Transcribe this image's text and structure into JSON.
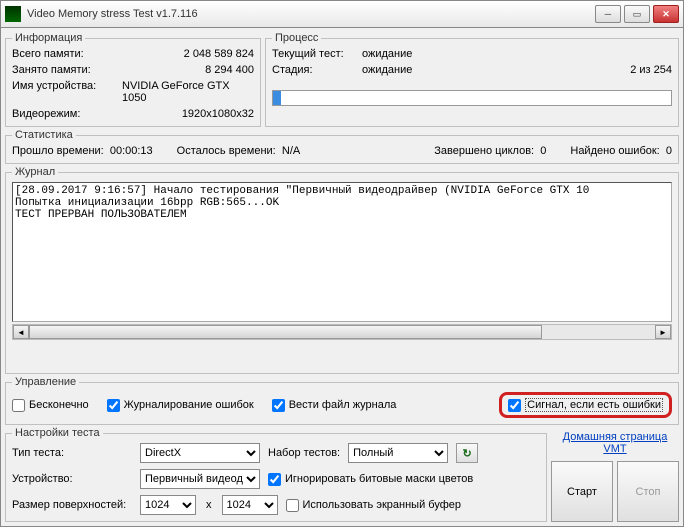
{
  "window": {
    "title": "Video Memory stress Test v1.7.116"
  },
  "info": {
    "legend": "Информация",
    "total_label": "Всего памяти:",
    "total": "2 048 589 824",
    "used_label": "Занято памяти:",
    "used": "8 294 400",
    "device_label": "Имя устройства:",
    "device": "NVIDIA GeForce GTX 1050",
    "mode_label": "Видеорежим:",
    "mode": "1920x1080x32"
  },
  "process": {
    "legend": "Процесс",
    "current_label": "Текущий тест:",
    "current": "ожидание",
    "stage_label": "Стадия:",
    "stage": "ожидание",
    "counter": "2 из 254"
  },
  "stats": {
    "legend": "Статистика",
    "elapsed_label": "Прошло времени:",
    "elapsed": "00:00:13",
    "remain_label": "Осталось времени:",
    "remain": "N/A",
    "cycles_label": "Завершено циклов:",
    "cycles": "0",
    "errors_label": "Найдено ошибок:",
    "errors": "0"
  },
  "log": {
    "legend": "Журнал",
    "text": "[28.09.2017 9:16:57] Начало тестирования \"Первичный видеодрайвер (NVIDIA GeForce GTX 10\nПопытка инициализации 16bpp RGB:565...OK\nТЕСТ ПРЕРВАН ПОЛЬЗОВАТЕЛЕМ"
  },
  "ctrl": {
    "legend": "Управление",
    "infinite": "Бесконечно",
    "log_errors": "Журналирование ошибок",
    "log_file": "Вести файл журнала",
    "signal": "Сигнал, если есть ошибки"
  },
  "settings": {
    "legend": "Настройки теста",
    "type_label": "Тип теста:",
    "type": "DirectX",
    "set_label": "Набор тестов:",
    "set": "Полный",
    "device_label": "Устройство:",
    "device": "Первичный видеод",
    "ignore_masks": "Игнорировать битовые маски цветов",
    "surf_label": "Размер поверхностей:",
    "surf_w": "1024",
    "surf_h": "1024",
    "use_offscreen": "Использовать экранный буфер"
  },
  "link": "Домашняя страница VMT",
  "buttons": {
    "start": "Старт",
    "stop": "Стоп"
  }
}
